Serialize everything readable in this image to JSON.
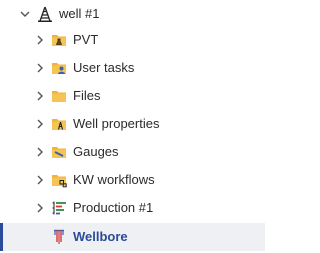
{
  "tree": {
    "root": {
      "label": "well #1",
      "icon": "well-derrick-icon",
      "expanded": true
    },
    "children": [
      {
        "label": "PVT",
        "icon": "pvt-folder-icon",
        "expanded": false
      },
      {
        "label": "User tasks",
        "icon": "user-tasks-folder-icon",
        "expanded": false
      },
      {
        "label": "Files",
        "icon": "folder-icon",
        "expanded": false
      },
      {
        "label": "Well properties",
        "icon": "well-properties-folder-icon",
        "expanded": false
      },
      {
        "label": "Gauges",
        "icon": "gauges-folder-icon",
        "expanded": false
      },
      {
        "label": "KW workflows",
        "icon": "workflows-folder-icon",
        "expanded": false
      },
      {
        "label": "Production #1",
        "icon": "production-icon",
        "expanded": false
      },
      {
        "label": "Wellbore",
        "icon": "wellbore-icon",
        "selected": true
      }
    ]
  },
  "colors": {
    "folder": "#f0b43c",
    "folder_dark": "#d99a22",
    "selection_accent": "#2a4b9b",
    "selection_background": "#eef0f4",
    "chevron": "#555555"
  }
}
